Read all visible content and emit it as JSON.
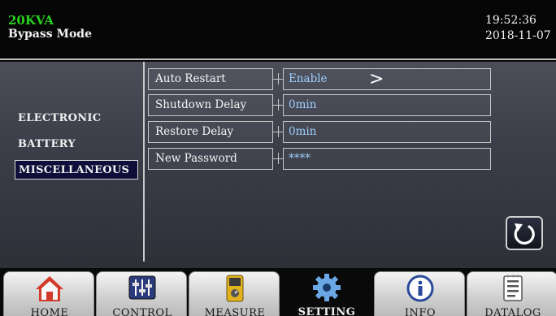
{
  "header": {
    "model": "20KVA",
    "mode": "Bypass Mode",
    "time": "19:52:36",
    "date": "2018-11-07"
  },
  "menu": {
    "items": [
      {
        "label": "ELECTRONIC",
        "selected": false
      },
      {
        "label": "BATTERY",
        "selected": false
      },
      {
        "label": "MISCELLANEOUS",
        "selected": true
      }
    ]
  },
  "settings": [
    {
      "label": "Auto Restart",
      "value": "Enable",
      "has_arrow": true
    },
    {
      "label": "Shutdown Delay",
      "value": "0min",
      "has_arrow": false
    },
    {
      "label": "Restore Delay",
      "value": "0min",
      "has_arrow": false
    },
    {
      "label": "New Password",
      "value": "****",
      "has_arrow": false
    }
  ],
  "arrow_glyph": ">",
  "nav": {
    "tabs": [
      {
        "label": "HOME",
        "icon": "home-icon"
      },
      {
        "label": "CONTROL",
        "icon": "sliders-icon"
      },
      {
        "label": "MEASURE",
        "icon": "meter-icon"
      },
      {
        "label": "SETTING",
        "icon": "gear-icon",
        "active": true
      },
      {
        "label": "INFO",
        "icon": "info-icon"
      },
      {
        "label": "DATALOG",
        "icon": "log-icon"
      }
    ]
  },
  "colors": {
    "model_text": "#27d21e",
    "value_text": "#9fd0ff",
    "panel_bg": "#3a3d47",
    "selected_bg": "#0d0f3a"
  }
}
